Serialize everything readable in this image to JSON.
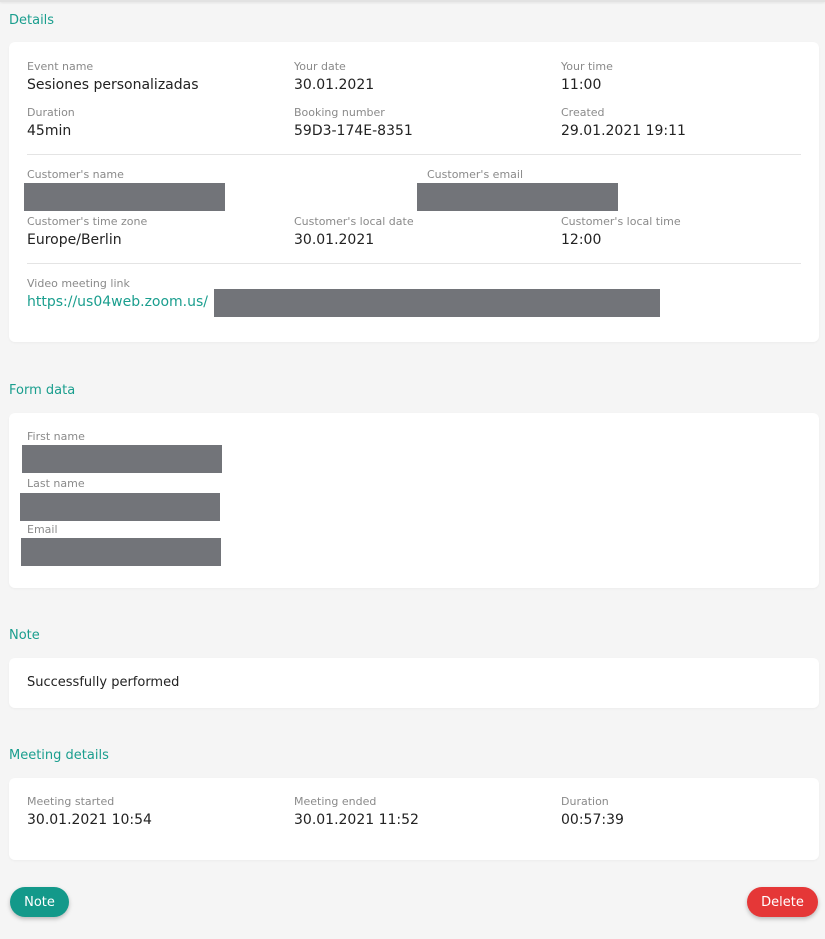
{
  "details": {
    "title": "Details",
    "event_name": {
      "label": "Event name",
      "value": "Sesiones personalizadas"
    },
    "your_date": {
      "label": "Your date",
      "value": "30.01.2021"
    },
    "your_time": {
      "label": "Your time",
      "value": "11:00"
    },
    "duration": {
      "label": "Duration",
      "value": "45min"
    },
    "booking_number": {
      "label": "Booking number",
      "value": "59D3-174E-8351"
    },
    "created": {
      "label": "Created",
      "value": "29.01.2021 19:11"
    },
    "customer_name": {
      "label": "Customer's name"
    },
    "customer_email": {
      "label": "Customer's email"
    },
    "customer_time_zone": {
      "label": "Customer's time zone",
      "value": "Europe/Berlin"
    },
    "customer_local_date": {
      "label": "Customer's local date",
      "value": "30.01.2021"
    },
    "customer_local_time": {
      "label": "Customer's local time",
      "value": "12:00"
    },
    "video_link": {
      "label": "Video meeting link",
      "value": "https://us04web.zoom.us/"
    }
  },
  "form_data": {
    "title": "Form data",
    "first_name_label": "First name",
    "last_name_label": "Last name",
    "email_label": "Email"
  },
  "note": {
    "title": "Note",
    "text": "Successfully performed"
  },
  "meeting_details": {
    "title": "Meeting details",
    "started": {
      "label": "Meeting started",
      "value": "30.01.2021 10:54"
    },
    "ended": {
      "label": "Meeting ended",
      "value": "30.01.2021 11:52"
    },
    "duration": {
      "label": "Duration",
      "value": "00:57:39"
    }
  },
  "buttons": {
    "note": "Note",
    "delete": "Delete"
  },
  "colors": {
    "accent": "#1a9e8e",
    "danger": "#e53737",
    "redaction": "#727479"
  }
}
